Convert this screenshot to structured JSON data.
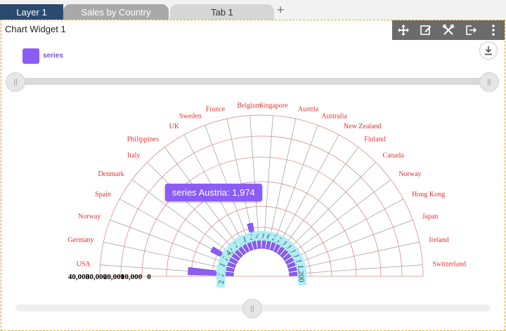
{
  "tabs": [
    {
      "label": "Layer 1"
    },
    {
      "label": "Sales by Country"
    },
    {
      "label": "Tab 1"
    }
  ],
  "add_tab_symbol": "+",
  "widget": {
    "title": "Chart Widget 1",
    "toolbar_icons": [
      "move-icon",
      "edit-icon",
      "tools-icon",
      "export-icon",
      "more-icon"
    ],
    "download_icon": "download-icon"
  },
  "legend": {
    "label": "series",
    "color": "#8b5cf6"
  },
  "tooltip": {
    "text": "series Austria: 1,974"
  },
  "colors": {
    "series": "#8b5cf6",
    "grid": "#d98c8c",
    "labels": "#e03030",
    "data_label_bg": "#aeeef5"
  },
  "radial_labels": [
    "USA",
    "Germany",
    "Norway",
    "Spain",
    "Denmark",
    "Italy",
    "Philippines",
    "UK",
    "Sweden",
    "France",
    "Belgium",
    "Singapore",
    "Austria",
    "Australia",
    "New Zealand",
    "Finland",
    "Canada",
    "Norway",
    "Hong Kong",
    "Japan",
    "Ireland",
    "Switzerland"
  ],
  "value_axis_labels": [
    "40,000",
    "30,000",
    "20,000",
    "10,000",
    "0"
  ],
  "chart_data": {
    "type": "bar",
    "polar": true,
    "categories": [
      "USA",
      "Germany",
      "Norway",
      "Spain",
      "Denmark",
      "Italy",
      "Philippines",
      "UK",
      "Sweden",
      "France",
      "Belgium",
      "Singapore",
      "Austria",
      "Australia",
      "New Zealand",
      "Finland",
      "Canada",
      "Norway",
      "Hong Kong",
      "Japan",
      "Ireland",
      "Switzerland"
    ],
    "series": [
      {
        "name": "series",
        "values": [
          21659,
          2148,
          1082,
          12429,
          2197,
          4075,
          961,
          2053,
          2606,
          11092,
          2000,
          4174,
          1974,
          6263,
          2305,
          2263,
          1560,
          1596,
          1342,
          1490,
          1078,
          1200
        ]
      }
    ],
    "ylim": [
      0,
      40000
    ],
    "legend_position": "top-left"
  }
}
